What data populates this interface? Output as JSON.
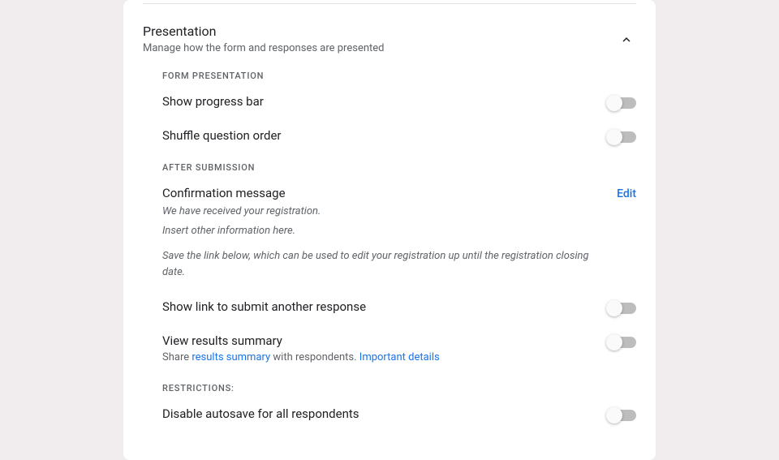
{
  "section": {
    "title": "Presentation",
    "subtitle": "Manage how the form and responses are presented"
  },
  "categories": {
    "formPresentation": "FORM PRESENTATION",
    "afterSubmission": "AFTER SUBMISSION",
    "restrictions": "RESTRICTIONS:"
  },
  "settings": {
    "showProgressBar": {
      "label": "Show progress bar"
    },
    "shuffleQuestionOrder": {
      "label": "Shuffle question order"
    },
    "confirmationMessage": {
      "label": "Confirmation message",
      "line1": "We have received your registration.",
      "line2": "Insert other information here.",
      "help": "Save the link below, which can be used to edit your registration up until the registration closing date.",
      "editLabel": "Edit"
    },
    "showLinkSubmitAnother": {
      "label": "Show link to submit another response"
    },
    "viewResultsSummary": {
      "label": "View results summary",
      "shareText1": "Share ",
      "shareLink1": "results summary",
      "shareText2": " with respondents. ",
      "shareLink2": "Important details"
    },
    "disableAutosave": {
      "label": "Disable autosave for all respondents"
    }
  }
}
